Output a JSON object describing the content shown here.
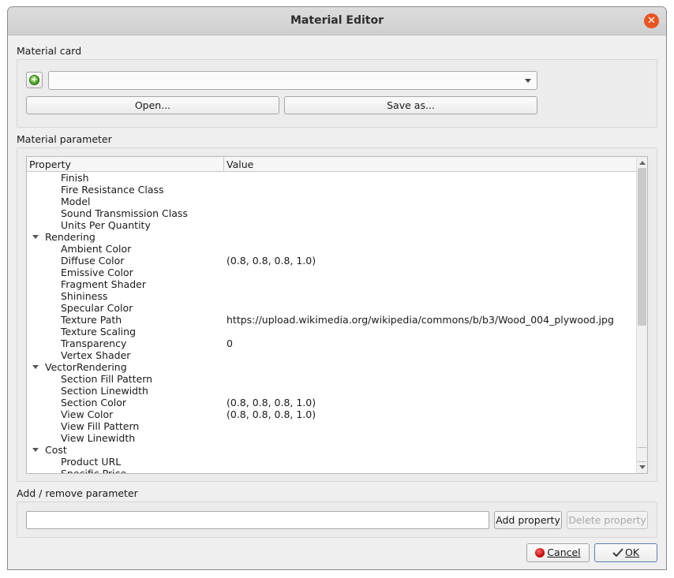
{
  "window": {
    "title": "Material Editor",
    "close_icon": "close-icon"
  },
  "material_card": {
    "label": "Material card",
    "combo_value": "",
    "open_label": "Open...",
    "save_as_label": "Save as..."
  },
  "material_parameter": {
    "label": "Material parameter",
    "columns": [
      "Property",
      "Value"
    ],
    "rows": [
      {
        "name": "Finish",
        "value": "",
        "group": false
      },
      {
        "name": "Fire Resistance Class",
        "value": "",
        "group": false
      },
      {
        "name": "Model",
        "value": "",
        "group": false
      },
      {
        "name": "Sound Transmission Class",
        "value": "",
        "group": false
      },
      {
        "name": "Units Per Quantity",
        "value": "",
        "group": false
      },
      {
        "name": "Rendering",
        "value": "",
        "group": true
      },
      {
        "name": "Ambient Color",
        "value": "",
        "group": false
      },
      {
        "name": "Diffuse Color",
        "value": "(0.8, 0.8, 0.8, 1.0)",
        "group": false
      },
      {
        "name": "Emissive Color",
        "value": "",
        "group": false
      },
      {
        "name": "Fragment Shader",
        "value": "",
        "group": false
      },
      {
        "name": "Shininess",
        "value": "",
        "group": false
      },
      {
        "name": "Specular Color",
        "value": "",
        "group": false
      },
      {
        "name": "Texture Path",
        "value": "https://upload.wikimedia.org/wikipedia/commons/b/b3/Wood_004_plywood.jpg",
        "group": false
      },
      {
        "name": "Texture Scaling",
        "value": "",
        "group": false
      },
      {
        "name": "Transparency",
        "value": "0",
        "group": false
      },
      {
        "name": "Vertex Shader",
        "value": "",
        "group": false
      },
      {
        "name": "VectorRendering",
        "value": "",
        "group": true
      },
      {
        "name": "Section Fill Pattern",
        "value": "",
        "group": false
      },
      {
        "name": "Section Linewidth",
        "value": "",
        "group": false
      },
      {
        "name": "Section Color",
        "value": "(0.8, 0.8, 0.8, 1.0)",
        "group": false
      },
      {
        "name": "View Color",
        "value": "(0.8, 0.8, 0.8, 1.0)",
        "group": false
      },
      {
        "name": "View Fill Pattern",
        "value": "",
        "group": false
      },
      {
        "name": "View Linewidth",
        "value": "",
        "group": false
      },
      {
        "name": "Cost",
        "value": "",
        "group": true
      },
      {
        "name": "Product URL",
        "value": "",
        "group": false
      },
      {
        "name": "Specific Price",
        "value": "",
        "group": false
      }
    ]
  },
  "add_remove": {
    "label": "Add / remove parameter",
    "input_value": "",
    "add_label": "Add property",
    "delete_label": "Delete property"
  },
  "footer": {
    "cancel_label": "Cancel",
    "ok_label": "OK"
  },
  "colors": {
    "accent_close": "#e95420",
    "default_button_border": "#5b7fb5"
  }
}
